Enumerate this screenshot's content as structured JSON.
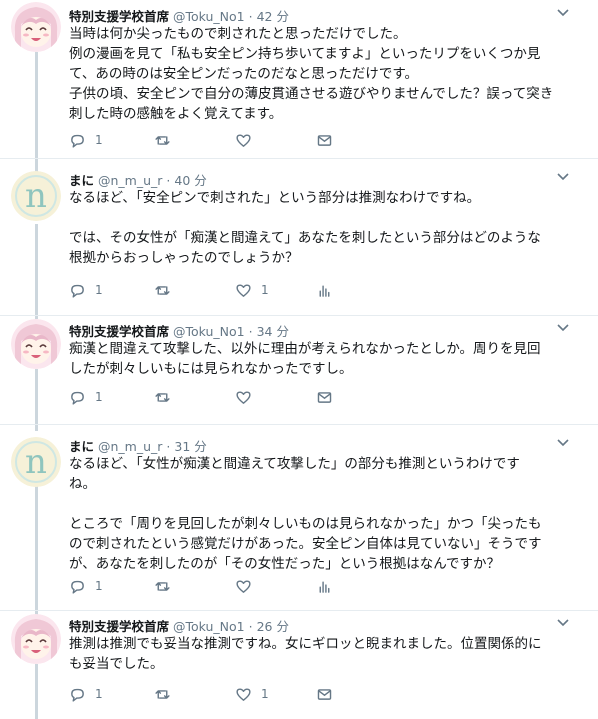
{
  "tweets": [
    {
      "author": "特別支援学校首席",
      "handle": "@Toku_No1",
      "sep": "·",
      "time": "42 分",
      "avatar": "anime-girl",
      "lines": [
        "当時は何か尖ったもので刺されたと思っただけでした。",
        "例の漫画を見て「私も安全ピン持ち歩いてますよ」といったリプをいくつか見",
        "て、あの時のは安全ピンだったのだなと思っただけです。",
        "子供の頃、安全ピンで自分の薄皮貫通させる遊びやりませんでした？誤って突き",
        "刺した時の感触をよく覚えてます。"
      ],
      "reply_count": "1",
      "retweet_count": "",
      "like_count": "",
      "last_action": "dm-icon"
    },
    {
      "author": "まに",
      "handle": "@n_m_u_r",
      "sep": "·",
      "time": "40 分",
      "avatar": "letter-n",
      "lines": [
        "なるほど、「安全ピンで刺された」という部分は推測なわけですね。",
        "",
        "では、その女性が「痴漢と間違えて」あなたを刺したという部分はどのような",
        "根拠からおっしゃったのでしょうか？"
      ],
      "reply_count": "1",
      "retweet_count": "",
      "like_count": "1",
      "last_action": "analytics-icon"
    },
    {
      "author": "特別支援学校首席",
      "handle": "@Toku_No1",
      "sep": "·",
      "time": "34 分",
      "avatar": "anime-girl",
      "lines": [
        "痴漢と間違えて攻撃した、以外に理由が考えられなかったとしか。周りを見回",
        "したが刺々しいもには見られなかったですし。"
      ],
      "reply_count": "1",
      "retweet_count": "",
      "like_count": "",
      "last_action": "dm-icon"
    },
    {
      "author": "まに",
      "handle": "@n_m_u_r",
      "sep": "·",
      "time": "31 分",
      "avatar": "letter-n",
      "lines": [
        "なるほど、「女性が痴漢と間違えて攻撃した」の部分も推測というわけです",
        "ね。",
        "",
        "ところで「周りを見回したが刺々しいものは見られなかった」かつ「尖ったも",
        "ので刺されたという感覚だけがあった。安全ピン自体は見ていない」そうです",
        "が、あなたを刺したのが「その女性だった」という根拠はなんですか？"
      ],
      "reply_count": "1",
      "retweet_count": "",
      "like_count": "",
      "last_action": "analytics-icon"
    },
    {
      "author": "特別支援学校首席",
      "handle": "@Toku_No1",
      "sep": "·",
      "time": "26 分",
      "avatar": "anime-girl",
      "lines": [
        "推測は推測でも妥当な推測ですね。女にギロッと睨まれました。位置関係的に",
        "も妥当でした。"
      ],
      "reply_count": "1",
      "retweet_count": "",
      "like_count": "1",
      "last_action": "dm-icon"
    }
  ],
  "colors": {
    "thread_line": "#ccd6dd",
    "icon_gray": "#657786",
    "text": "#14171a",
    "separator": "#e6ecf0"
  }
}
